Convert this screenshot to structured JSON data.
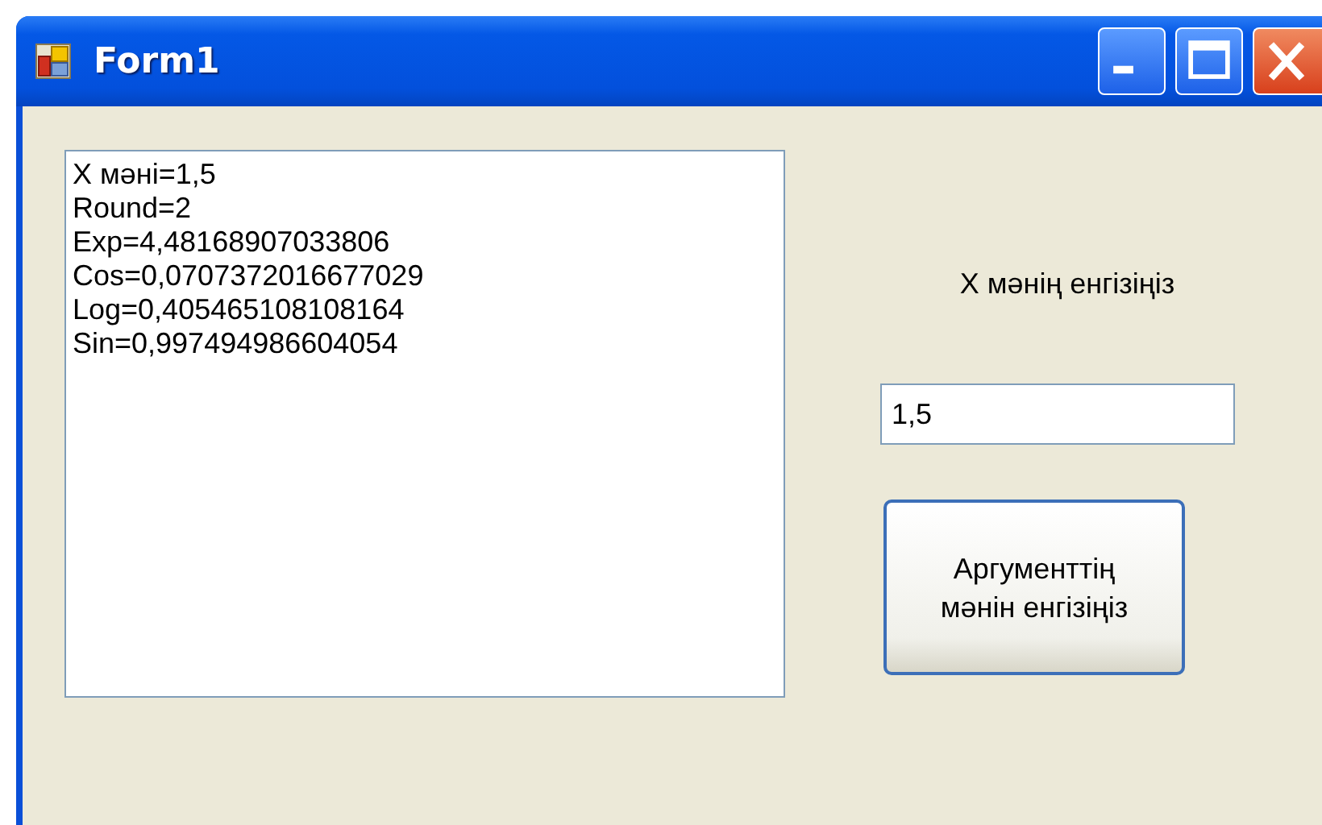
{
  "window": {
    "title": "Form1",
    "controls": [
      {
        "kind": "minimize"
      },
      {
        "kind": "maximize"
      },
      {
        "kind": "close"
      }
    ]
  },
  "output": {
    "lines": [
      "X мәні=1,5",
      "Round=2",
      "Exp=4,48168907033806",
      "Cos=0,0707372016677029",
      "Log=0,405465108108164",
      "Sin=0,997494986604054"
    ]
  },
  "prompt_label": "X мәнің енгізіңіз",
  "input": {
    "value": "1,5"
  },
  "button": {
    "label": "Аргументтің\nмәнін енгізіңіз"
  }
}
